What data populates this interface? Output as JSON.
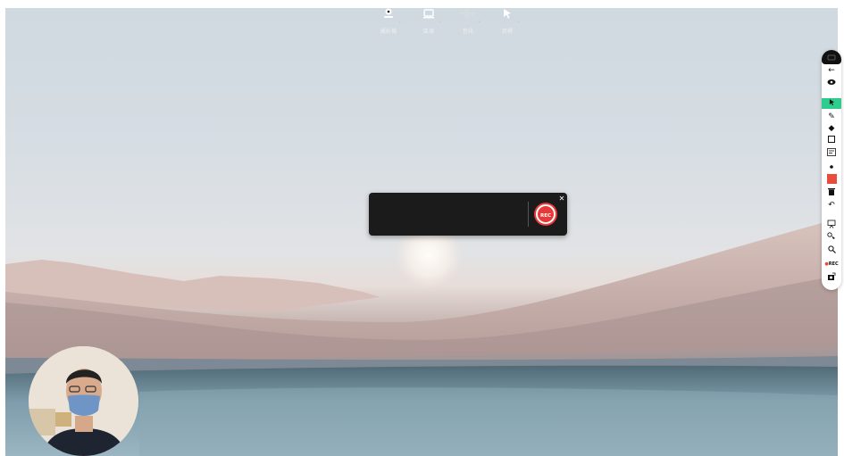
{
  "recorder": {
    "buttons": [
      {
        "label": "攝影機",
        "icon": "camera-icon"
      },
      {
        "label": "區域",
        "icon": "screen-icon"
      },
      {
        "label": "音訊",
        "icon": "audio-wave-icon"
      },
      {
        "label": "游標",
        "icon": "cursor-icon"
      }
    ],
    "record_label": "REC",
    "close_icon": "close-icon"
  },
  "toolbar": {
    "tools": [
      "back-arrow-icon",
      "eye-icon",
      "pointer-icon",
      "pen-icon",
      "eraser-icon",
      "rectangle-icon",
      "text-box-icon",
      "dot-size-icon",
      "color-swatch",
      "trash-icon",
      "undo-icon",
      "whiteboard-icon",
      "spotlight-icon",
      "zoom-icon",
      "rec-indicator",
      "screenshot-icon"
    ],
    "active_tool": "pointer-icon",
    "active_color": "#e74c3c",
    "rec_text": "REC"
  }
}
